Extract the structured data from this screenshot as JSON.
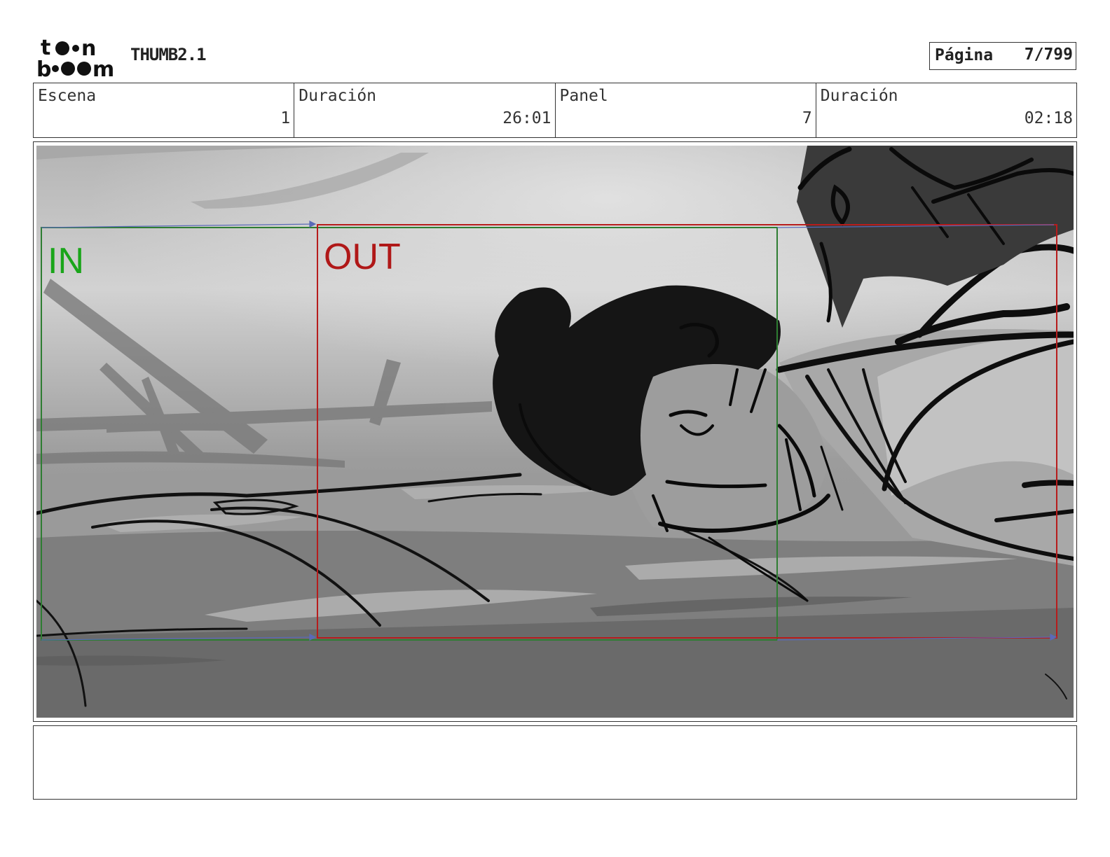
{
  "header": {
    "logo": {
      "icon": "toon-boom-logo",
      "text": "toon boom"
    },
    "title": "THUMB2.1",
    "page": {
      "label": "Página",
      "value": "7/799"
    }
  },
  "info": {
    "cells": [
      {
        "label": "Escena",
        "value": "1"
      },
      {
        "label": "Duración",
        "value": "26:01"
      },
      {
        "label": "Panel",
        "value": "7"
      },
      {
        "label": "Duración",
        "value": "02:18"
      }
    ]
  },
  "panel": {
    "in_label": "IN",
    "out_label": "OUT",
    "colors": {
      "in": "#2e7d32",
      "in_text": "#1aa51a",
      "out": "#b71c1c",
      "out_text": "#b01818",
      "sky": "#bdbdbd",
      "ground": "#6e6e6e"
    }
  },
  "notes": {
    "text": ""
  }
}
